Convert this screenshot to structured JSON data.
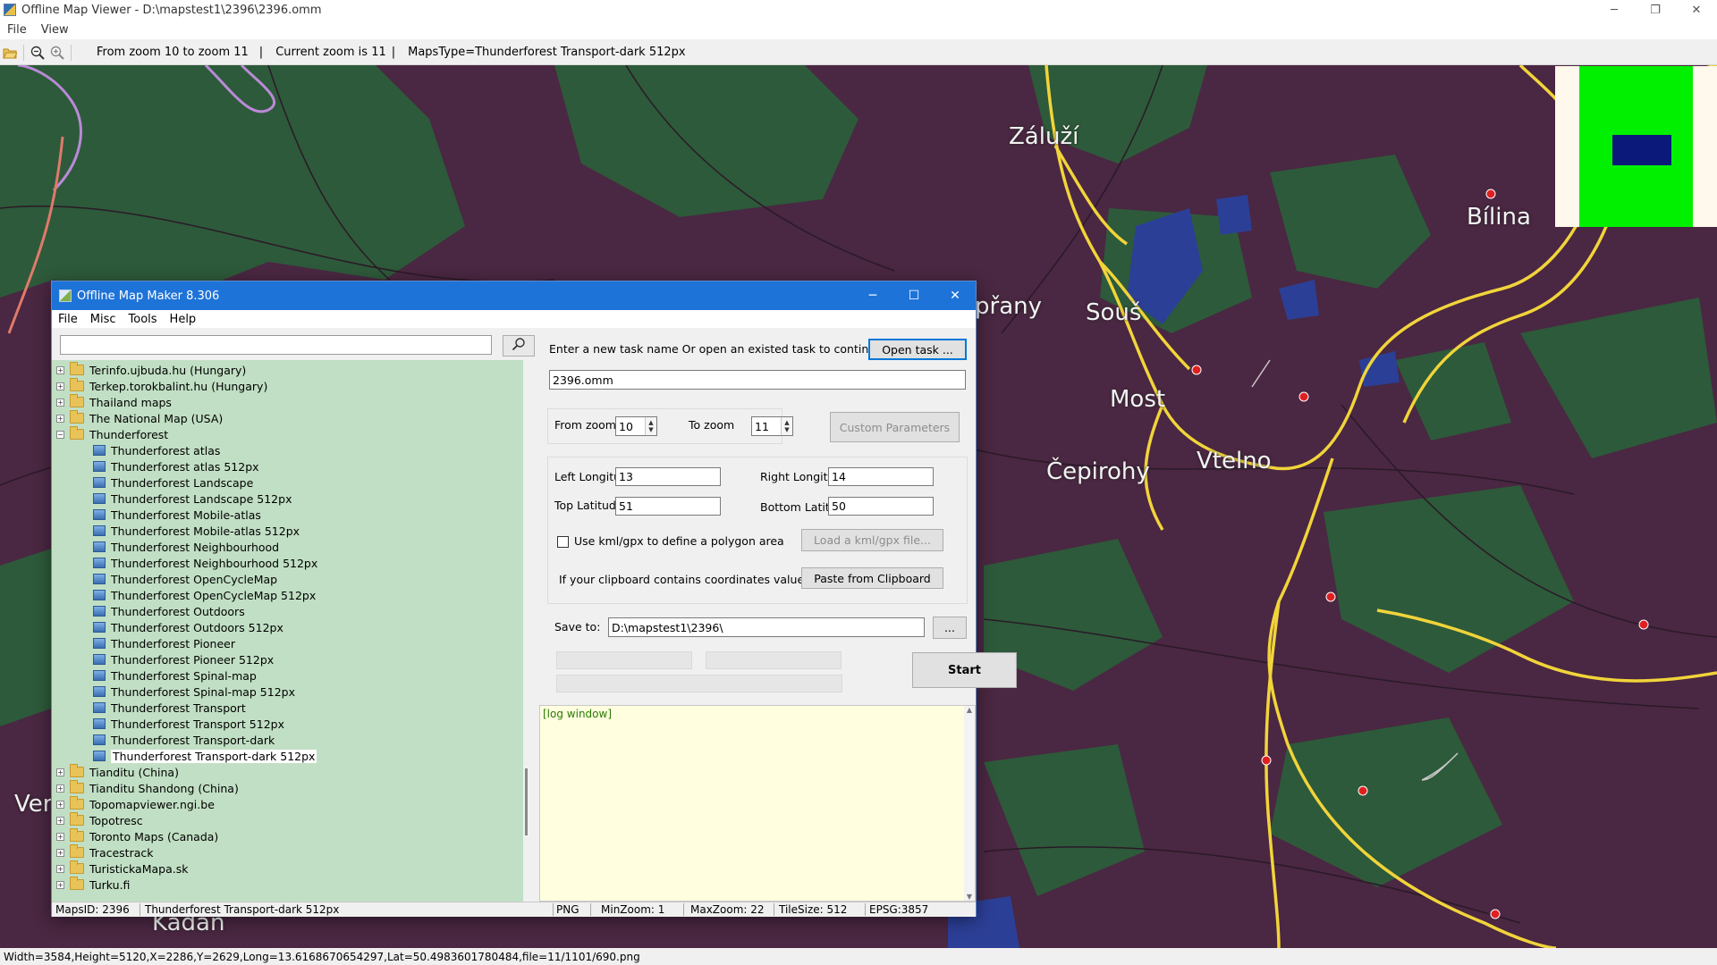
{
  "window": {
    "title": "Offline Map Viewer - D:\\mapstest1\\2396\\2396.omm",
    "controls": {
      "minimize": "─",
      "maximize": "❐",
      "close": "✕"
    }
  },
  "menu": {
    "file": "File",
    "view": "View"
  },
  "toolbar": {
    "zoom_range": "From zoom 10 to zoom 11",
    "current_zoom": "Current zoom is 11",
    "maps_type": "MapsType=Thunderforest Transport-dark 512px",
    "separator": "|"
  },
  "map": {
    "background_color": "#4a2742",
    "labels": {
      "zaluzi": "Záluží",
      "bilina": "Bílina",
      "sous": "Souš",
      "most": "Most",
      "cepirohy": "Čepirohy",
      "vtelno": "Vtelno",
      "prany": "přany",
      "kadan": "Kadaň",
      "ver": "Ver"
    }
  },
  "statusbar": {
    "text": "Width=3584,Height=5120,X=2286,Y=2629,Long=13.6168670654297,Lat=50.4983601780484,file=11/1101/690.png"
  },
  "dialog": {
    "title": "Offline Map Maker 8.306",
    "controls": {
      "minimize": "─",
      "maximize": "☐",
      "close": "✕"
    },
    "menu": {
      "file": "File",
      "misc": "Misc",
      "tools": "Tools",
      "help": "Help"
    },
    "search": {
      "value": "",
      "icon": "search-icon"
    },
    "tree": [
      {
        "label": "Terinfo.ujbuda.hu (Hungary)",
        "kind": "folder",
        "expander": "+"
      },
      {
        "label": "Terkep.torokbalint.hu (Hungary)",
        "kind": "folder",
        "expander": "+"
      },
      {
        "label": "Thailand maps",
        "kind": "folder",
        "expander": "+"
      },
      {
        "label": "The National Map (USA)",
        "kind": "folder",
        "expander": "+"
      },
      {
        "label": "Thunderforest",
        "kind": "folder",
        "expander": "−"
      },
      {
        "label": "Thunderforest atlas",
        "kind": "map"
      },
      {
        "label": "Thunderforest atlas 512px",
        "kind": "map"
      },
      {
        "label": "Thunderforest Landscape",
        "kind": "map"
      },
      {
        "label": "Thunderforest Landscape 512px",
        "kind": "map"
      },
      {
        "label": "Thunderforest Mobile-atlas",
        "kind": "map"
      },
      {
        "label": "Thunderforest Mobile-atlas 512px",
        "kind": "map"
      },
      {
        "label": "Thunderforest Neighbourhood",
        "kind": "map"
      },
      {
        "label": "Thunderforest Neighbourhood 512px",
        "kind": "map"
      },
      {
        "label": "Thunderforest OpenCycleMap",
        "kind": "map"
      },
      {
        "label": "Thunderforest OpenCycleMap 512px",
        "kind": "map"
      },
      {
        "label": "Thunderforest Outdoors",
        "kind": "map"
      },
      {
        "label": "Thunderforest Outdoors 512px",
        "kind": "map"
      },
      {
        "label": "Thunderforest Pioneer",
        "kind": "map"
      },
      {
        "label": "Thunderforest Pioneer 512px",
        "kind": "map"
      },
      {
        "label": "Thunderforest Spinal-map",
        "kind": "map"
      },
      {
        "label": "Thunderforest Spinal-map 512px",
        "kind": "map"
      },
      {
        "label": "Thunderforest Transport",
        "kind": "map"
      },
      {
        "label": "Thunderforest Transport 512px",
        "kind": "map"
      },
      {
        "label": "Thunderforest Transport-dark",
        "kind": "map"
      },
      {
        "label": "Thunderforest Transport-dark 512px",
        "kind": "map",
        "selected": true
      },
      {
        "label": "Tianditu (China)",
        "kind": "folder",
        "expander": "+"
      },
      {
        "label": "Tianditu Shandong (China)",
        "kind": "folder",
        "expander": "+"
      },
      {
        "label": "Topomapviewer.ngi.be",
        "kind": "folder",
        "expander": "+"
      },
      {
        "label": "Topotresc",
        "kind": "folder",
        "expander": "+"
      },
      {
        "label": "Toronto Maps (Canada)",
        "kind": "folder",
        "expander": "+"
      },
      {
        "label": "Tracestrack",
        "kind": "folder",
        "expander": "+"
      },
      {
        "label": "TuristickaMapa.sk",
        "kind": "folder",
        "expander": "+"
      },
      {
        "label": "Turku.fi",
        "kind": "folder",
        "expander": "+"
      }
    ],
    "task": {
      "prompt": "Enter a new task name Or open an existed task to continue:",
      "open_button": "Open task ...",
      "name_value": "2396.omm"
    },
    "zoom": {
      "from_label": "From zoom",
      "from_value": "10",
      "to_label": "To zoom",
      "to_value": "11",
      "custom_button": "Custom Parameters"
    },
    "coords": {
      "left_lon_label": "Left Longitude",
      "left_lon_value": "13",
      "right_lon_label": "Right Longitude",
      "right_lon_value": "14",
      "top_lat_label": "Top Latitude",
      "top_lat_value": "51",
      "bottom_lat_label": "Bottom Latitude",
      "bottom_lat_value": "50",
      "kml_checkbox_label": "Use kml/gpx to define a polygon area",
      "kml_checked": false,
      "kml_button": "Load a kml/gpx file...",
      "clipboard_label": "If your clipboard contains coordinates values:",
      "clipboard_button": "Paste from Clipboard"
    },
    "save": {
      "label": "Save to:",
      "path": "D:\\mapstest1\\2396\\",
      "browse_button": "..."
    },
    "start_button": "Start",
    "log": {
      "text": "[log window]"
    },
    "status": {
      "maps_id": "MapsID: 2396",
      "map_name": "Thunderforest Transport-dark 512px",
      "format": "PNG",
      "min_zoom": "MinZoom: 1",
      "max_zoom": "MaxZoom: 22",
      "tile_size": "TileSize: 512",
      "epsg": "EPSG:3857"
    }
  }
}
